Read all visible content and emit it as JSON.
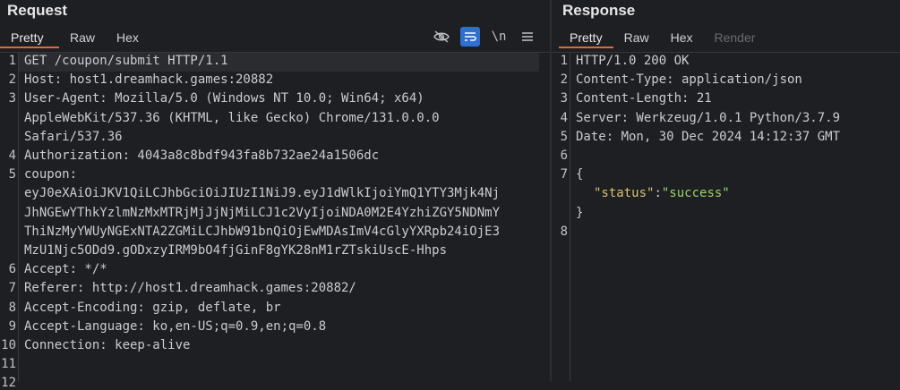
{
  "request": {
    "title": "Request",
    "tabs": [
      "Pretty",
      "Raw",
      "Hex"
    ],
    "tool_icons": [
      "eye-slash-icon",
      "wrap-lines-icon",
      "newline-icon",
      "menu-icon"
    ],
    "newline_label": "\\n",
    "lines": [
      {
        "num": "1",
        "text": "GET /coupon/submit HTTP/1.1"
      },
      {
        "num": "2",
        "text": "Host: host1.dreamhack.games:20882"
      },
      {
        "num": "3",
        "text": "User-Agent: Mozilla/5.0 (Windows NT 10.0; Win64; x64)"
      },
      {
        "num": "",
        "text": "AppleWebKit/537.36 (KHTML, like Gecko) Chrome/131.0.0.0"
      },
      {
        "num": "",
        "text": "Safari/537.36"
      },
      {
        "num": "4",
        "text": "Authorization: 4043a8c8bdf943fa8b732ae24a1506dc"
      },
      {
        "num": "5",
        "text": "coupon:"
      },
      {
        "num": "",
        "text": "eyJ0eXAiOiJKV1QiLCJhbGciOiJIUzI1NiJ9.eyJ1dWlkIjoiYmQ1YTY3Mjk4Nj"
      },
      {
        "num": "",
        "text": "JhNGEwYThkYzlmNzMxMTRjMjJjNjMiLCJ1c2VyIjoiNDA0M2E4YzhiZGY5NDNmY"
      },
      {
        "num": "",
        "text": "ThiNzMyYWUyNGExNTA2ZGMiLCJhbW91bnQiOjEwMDAsImV4cGlyYXRpb24iOjE3"
      },
      {
        "num": "",
        "text": "MzU1Njc5ODd9.gODxzyIRM9bO4fjGinF8gYK28nM1rZTskiUscE-Hhps"
      },
      {
        "num": "6",
        "text": "Accept: */*"
      },
      {
        "num": "7",
        "text": "Referer: http://host1.dreamhack.games:20882/"
      },
      {
        "num": "8",
        "text": "Accept-Encoding: gzip, deflate, br"
      },
      {
        "num": "9",
        "text": "Accept-Language: ko,en-US;q=0.9,en;q=0.8"
      },
      {
        "num": "10",
        "text": "Connection: keep-alive"
      },
      {
        "num": "11",
        "text": ""
      },
      {
        "num": "12",
        "text": ""
      }
    ]
  },
  "response": {
    "title": "Response",
    "tabs": [
      "Pretty",
      "Raw",
      "Hex",
      "Render"
    ],
    "lines": [
      {
        "num": "1",
        "text": "HTTP/1.0 200 OK"
      },
      {
        "num": "2",
        "text": "Content-Type: application/json"
      },
      {
        "num": "3",
        "text": "Content-Length: 21"
      },
      {
        "num": "4",
        "text": "Server: Werkzeug/1.0.1 Python/3.7.9"
      },
      {
        "num": "5",
        "text": "Date: Mon, 30 Dec 2024 14:12:37 GMT"
      },
      {
        "num": "6",
        "text": ""
      },
      {
        "num": "7",
        "text": "{"
      },
      {
        "num": "",
        "json_key": "\"status\"",
        "json_sep": ":",
        "json_val": "\"success\""
      },
      {
        "num": "",
        "text": "}"
      },
      {
        "num": "8",
        "text": ""
      }
    ]
  },
  "colors": {
    "background": "#1e1f22",
    "active_tab_underline": "#e0663d",
    "toggle_active": "#2f6fd1",
    "json_key": "#d9c26a",
    "json_string": "#9bd26a"
  }
}
